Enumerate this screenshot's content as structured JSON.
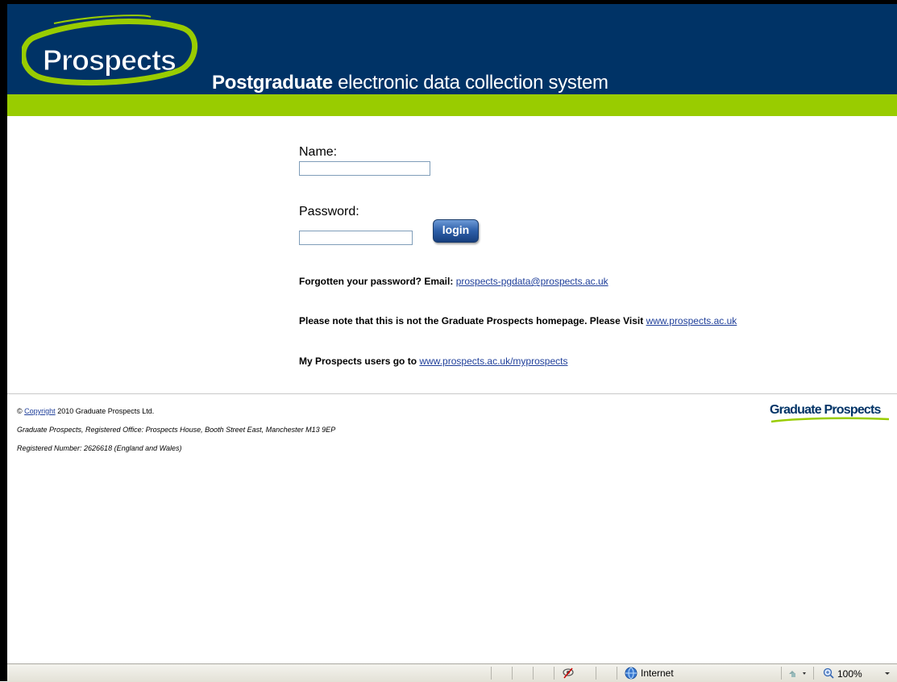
{
  "header": {
    "logo_text": "Prospects",
    "title_bold": "Postgraduate",
    "title_rest": " electronic data collection system"
  },
  "login": {
    "name_label": "Name:",
    "name_value": "",
    "password_label": "Password:",
    "password_value": "",
    "login_button": "login"
  },
  "info": {
    "forgot_text": "Forgotten your password? Email:",
    "forgot_link": "prospects-pgdata@prospects.ac.uk",
    "note_text": "Please note that this is not the Graduate Prospects homepage. Please Visit",
    "note_link": "www.prospects.ac.uk",
    "myprospects_text": "My Prospects users go to",
    "myprospects_link": "www.prospects.ac.uk/myprospects"
  },
  "footer": {
    "copyright_symbol": "©",
    "copyright_link": "Copyright",
    "copyright_rest": "2010 Graduate Prospects Ltd.",
    "registered_office": "Graduate Prospects, Registered Office: Prospects House, Booth Street East, Manchester M13 9EP",
    "registered_number": "Registered Number: 2626618 (England and Wales)",
    "brand": "Graduate Prospects"
  },
  "statusbar": {
    "zone": "Internet",
    "zoom": "100%"
  },
  "colors": {
    "header_bg": "#003366",
    "accent_green": "#99cc00",
    "link": "#1f3f9a"
  }
}
